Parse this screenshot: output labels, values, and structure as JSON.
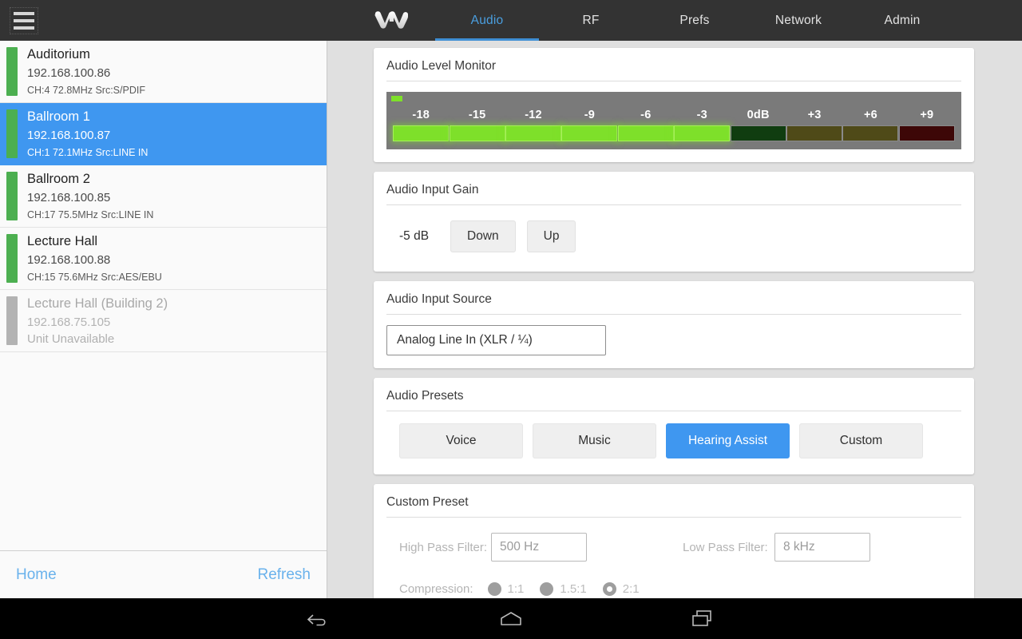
{
  "topbar": {
    "menu_icon": "hamburger-menu-icon",
    "logo_icon": "brand-w-logo",
    "tabs": [
      {
        "label": "Audio",
        "active": true
      },
      {
        "label": "RF",
        "active": false
      },
      {
        "label": "Prefs",
        "active": false
      },
      {
        "label": "Network",
        "active": false
      },
      {
        "label": "Admin",
        "active": false
      }
    ]
  },
  "sidebar": {
    "devices": [
      {
        "name": "Auditorium",
        "ip": "192.168.100.86",
        "meta": "CH:4  72.8MHz  Src:S/PDIF",
        "status": "online",
        "selected": false
      },
      {
        "name": "Ballroom 1",
        "ip": "192.168.100.87",
        "meta": "CH:1  72.1MHz  Src:LINE IN",
        "status": "online",
        "selected": true
      },
      {
        "name": "Ballroom 2",
        "ip": "192.168.100.85",
        "meta": "CH:17  75.5MHz  Src:LINE IN",
        "status": "online",
        "selected": false
      },
      {
        "name": "Lecture Hall",
        "ip": "192.168.100.88",
        "meta": "CH:15  75.6MHz  Src:AES/EBU",
        "status": "online",
        "selected": false
      },
      {
        "name": "Lecture Hall (Building 2)",
        "ip": "192.168.75.105",
        "meta": "Unit Unavailable",
        "status": "offline",
        "selected": false
      }
    ],
    "footer": {
      "home_label": "Home",
      "refresh_label": "Refresh"
    }
  },
  "main": {
    "level_monitor": {
      "title": "Audio Level Monitor",
      "segments": [
        {
          "label": "-18",
          "state": "on"
        },
        {
          "label": "-15",
          "state": "on"
        },
        {
          "label": "-12",
          "state": "on"
        },
        {
          "label": "-9",
          "state": "on"
        },
        {
          "label": "-6",
          "state": "on"
        },
        {
          "label": "-3",
          "state": "on"
        },
        {
          "label": "0dB",
          "state": "off-green"
        },
        {
          "label": "+3",
          "state": "off-yellow"
        },
        {
          "label": "+6",
          "state": "off-yellow"
        },
        {
          "label": "+9",
          "state": "off-red"
        }
      ],
      "active_color": "#7ee02a",
      "panel_color": "#7a7a7a"
    },
    "input_gain": {
      "title": "Audio Input Gain",
      "value": "-5 dB",
      "down_label": "Down",
      "up_label": "Up"
    },
    "input_source": {
      "title": "Audio Input Source",
      "value": "Analog Line In (XLR / ¼)"
    },
    "presets": {
      "title": "Audio Presets",
      "items": [
        {
          "label": "Voice",
          "active": false
        },
        {
          "label": "Music",
          "active": false
        },
        {
          "label": "Hearing Assist",
          "active": true
        },
        {
          "label": "Custom",
          "active": false
        }
      ],
      "accent_color": "#3f97f0"
    },
    "custom_preset": {
      "title": "Custom Preset",
      "disabled": true,
      "high_pass_label": "High Pass Filter:",
      "high_pass_value": "500 Hz",
      "low_pass_label": "Low Pass Filter:",
      "low_pass_value": "8 kHz",
      "compression_label": "Compression:",
      "compression_options": [
        {
          "label": "1:1",
          "checked": false
        },
        {
          "label": "1.5:1",
          "checked": false
        },
        {
          "label": "2:1",
          "checked": true
        }
      ]
    }
  },
  "android_nav": {
    "back_icon": "back-arrow-icon",
    "home_icon": "home-icon",
    "recents_icon": "recent-apps-icon"
  }
}
